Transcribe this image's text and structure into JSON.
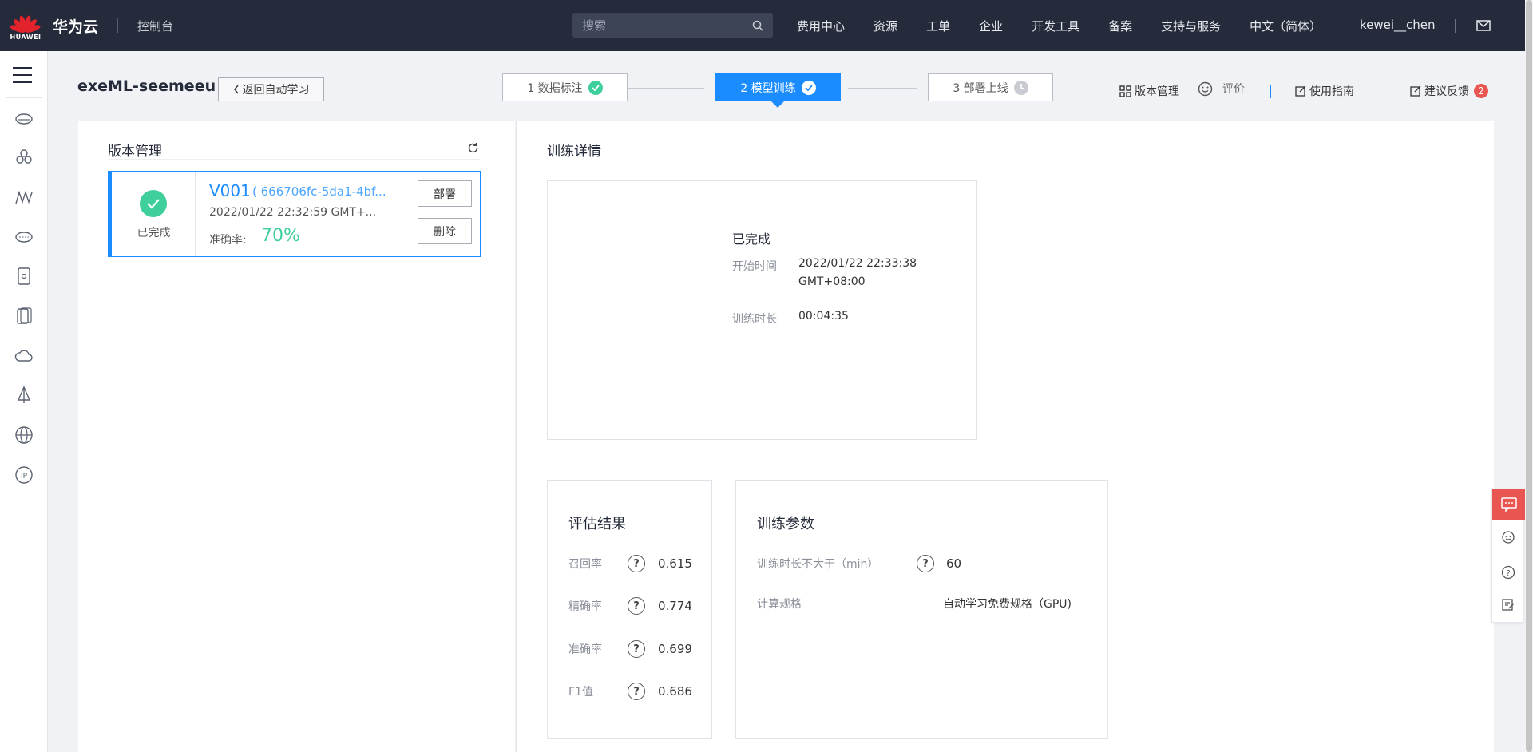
{
  "topbar": {
    "logo_text": "HUAWEI",
    "brand": "华为云",
    "console": "控制台",
    "search_placeholder": "搜索",
    "nav": [
      "费用中心",
      "资源",
      "工单",
      "企业",
      "开发工具",
      "备案",
      "支持与服务",
      "中文（简体）"
    ],
    "user": "kewei__chen"
  },
  "header": {
    "title": "exeML-seemeeu",
    "back_label": "返回自动学习",
    "steps": [
      {
        "label": "1 数据标注",
        "state": "done"
      },
      {
        "label": "2 模型训练",
        "state": "active"
      },
      {
        "label": "3 部署上线",
        "state": "pending"
      }
    ],
    "tools": {
      "version": "版本管理",
      "evaluate": "评价",
      "guide": "使用指南",
      "feedback": "建议反馈",
      "feedback_count": "2"
    }
  },
  "version_panel": {
    "title": "版本管理",
    "card": {
      "status": "已完成",
      "version": "V001",
      "id": "( 666706fc-5da1-4bf...",
      "time": "2022/01/22 22:32:59 GMT+...",
      "accuracy_label": "准确率:",
      "accuracy": "70%",
      "deploy": "部署",
      "delete": "删除"
    }
  },
  "training": {
    "title": "训练详情",
    "status": "已完成",
    "start_label": "开始时间",
    "start_value_line1": "2022/01/22 22:33:38",
    "start_value_line2": "GMT+08:00",
    "duration_label": "训练时长",
    "duration_value": "00:04:35"
  },
  "evaluation": {
    "title": "评估结果",
    "metrics": [
      {
        "label": "召回率",
        "value": "0.615"
      },
      {
        "label": "精确率",
        "value": "0.774"
      },
      {
        "label": "准确率",
        "value": "0.699"
      },
      {
        "label": "F1值",
        "value": "0.686"
      }
    ]
  },
  "params": {
    "title": "训练参数",
    "max_time_label": "训练时长不大于（min）",
    "max_time_value": "60",
    "spec_label": "计算规格",
    "spec_value": "自动学习免费规格（GPU)"
  },
  "colors": {
    "accent": "#1a8cff",
    "success": "#3fcf9b",
    "topbar": "#252b3a",
    "badge": "#e95550"
  }
}
